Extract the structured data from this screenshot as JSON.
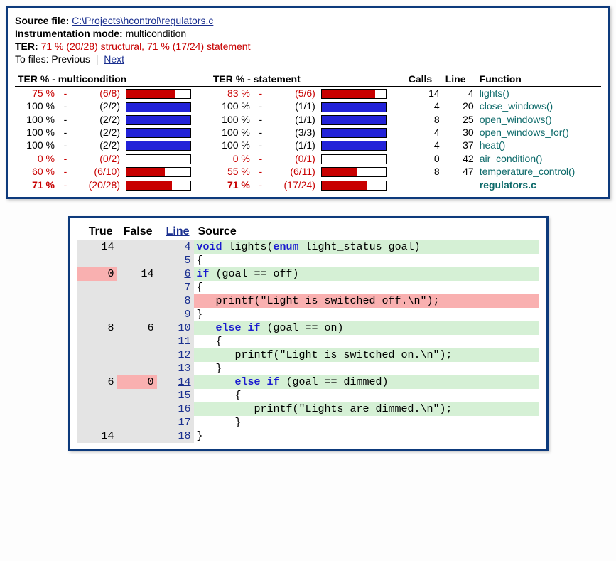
{
  "header": {
    "source_label": "Source file:",
    "source_path": "C:\\Projects\\hcontrol\\regulators.c",
    "mode_label": "Instrumentation mode:",
    "mode_value": "multicondition",
    "ter_label": "TER:",
    "ter_value": "71 % (20/28) structural, 71 % (17/24) statement",
    "tofiles_label": "To files:",
    "prev": "Previous",
    "next": "Next"
  },
  "cols": {
    "mc": "TER % - multicondition",
    "st": "TER % - statement",
    "calls": "Calls",
    "line": "Line",
    "func": "Function"
  },
  "rows": [
    {
      "mc_pct": "75 %",
      "mc_ratio": "(6/8)",
      "mc_fill": 75,
      "mc_bad": true,
      "st_pct": "83 %",
      "st_ratio": "(5/6)",
      "st_fill": 83,
      "st_bad": true,
      "calls": "14",
      "line": "4",
      "func": "lights()"
    },
    {
      "mc_pct": "100 %",
      "mc_ratio": "(2/2)",
      "mc_fill": 100,
      "mc_bad": false,
      "st_pct": "100 %",
      "st_ratio": "(1/1)",
      "st_fill": 100,
      "st_bad": false,
      "calls": "4",
      "line": "20",
      "func": "close_windows()"
    },
    {
      "mc_pct": "100 %",
      "mc_ratio": "(2/2)",
      "mc_fill": 100,
      "mc_bad": false,
      "st_pct": "100 %",
      "st_ratio": "(1/1)",
      "st_fill": 100,
      "st_bad": false,
      "calls": "8",
      "line": "25",
      "func": "open_windows()"
    },
    {
      "mc_pct": "100 %",
      "mc_ratio": "(2/2)",
      "mc_fill": 100,
      "mc_bad": false,
      "st_pct": "100 %",
      "st_ratio": "(3/3)",
      "st_fill": 100,
      "st_bad": false,
      "calls": "4",
      "line": "30",
      "func": "open_windows_for()"
    },
    {
      "mc_pct": "100 %",
      "mc_ratio": "(2/2)",
      "mc_fill": 100,
      "mc_bad": false,
      "st_pct": "100 %",
      "st_ratio": "(1/1)",
      "st_fill": 100,
      "st_bad": false,
      "calls": "4",
      "line": "37",
      "func": "heat()"
    },
    {
      "mc_pct": "0 %",
      "mc_ratio": "(0/2)",
      "mc_fill": 0,
      "mc_bad": true,
      "st_pct": "0 %",
      "st_ratio": "(0/1)",
      "st_fill": 0,
      "st_bad": true,
      "calls": "0",
      "line": "42",
      "func": "air_condition()"
    },
    {
      "mc_pct": "60 %",
      "mc_ratio": "(6/10)",
      "mc_fill": 60,
      "mc_bad": true,
      "st_pct": "55 %",
      "st_ratio": "(6/11)",
      "st_fill": 55,
      "st_bad": true,
      "calls": "8",
      "line": "47",
      "func": "temperature_control()"
    }
  ],
  "total": {
    "mc_pct": "71 %",
    "mc_ratio": "(20/28)",
    "mc_fill": 71,
    "st_pct": "71 %",
    "st_ratio": "(17/24)",
    "st_fill": 71,
    "file": "regulators.c"
  },
  "src_cols": {
    "true": "True",
    "false": "False",
    "line": "Line",
    "source": "Source"
  },
  "src_rows": [
    {
      "t": "14",
      "f": "",
      "t0": false,
      "f0": false,
      "ln": "4",
      "lnu": false,
      "cov": "g",
      "tokens": [
        [
          "kw",
          "void"
        ],
        [
          "pln",
          " lights("
        ],
        [
          "kw",
          "enum"
        ],
        [
          "pln",
          " light_status goal)"
        ]
      ]
    },
    {
      "t": "",
      "f": "",
      "t0": false,
      "f0": false,
      "ln": "5",
      "lnu": false,
      "cov": "",
      "tokens": [
        [
          "pln",
          "{"
        ]
      ]
    },
    {
      "t": "0",
      "f": "14",
      "t0": true,
      "f0": false,
      "ln": "6",
      "lnu": true,
      "cov": "g",
      "tokens": [
        [
          "kw",
          "if"
        ],
        [
          "pln",
          " (goal == off)"
        ]
      ]
    },
    {
      "t": "",
      "f": "",
      "t0": false,
      "f0": false,
      "ln": "7",
      "lnu": false,
      "cov": "",
      "tokens": [
        [
          "pln",
          "{"
        ]
      ]
    },
    {
      "t": "",
      "f": "",
      "t0": false,
      "f0": false,
      "ln": "8",
      "lnu": false,
      "cov": "r",
      "tokens": [
        [
          "pln",
          "   printf(\"Light is switched off.\\n\");"
        ]
      ]
    },
    {
      "t": "",
      "f": "",
      "t0": false,
      "f0": false,
      "ln": "9",
      "lnu": false,
      "cov": "",
      "tokens": [
        [
          "pln",
          "}"
        ]
      ]
    },
    {
      "t": "8",
      "f": "6",
      "t0": false,
      "f0": false,
      "ln": "10",
      "lnu": false,
      "cov": "g",
      "tokens": [
        [
          "pln",
          "   "
        ],
        [
          "kw",
          "else if"
        ],
        [
          "pln",
          " (goal == on)"
        ]
      ]
    },
    {
      "t": "",
      "f": "",
      "t0": false,
      "f0": false,
      "ln": "11",
      "lnu": false,
      "cov": "",
      "tokens": [
        [
          "pln",
          "   {"
        ]
      ]
    },
    {
      "t": "",
      "f": "",
      "t0": false,
      "f0": false,
      "ln": "12",
      "lnu": false,
      "cov": "g",
      "tokens": [
        [
          "pln",
          "      printf(\"Light is switched on.\\n\");"
        ]
      ]
    },
    {
      "t": "",
      "f": "",
      "t0": false,
      "f0": false,
      "ln": "13",
      "lnu": false,
      "cov": "",
      "tokens": [
        [
          "pln",
          "   }"
        ]
      ]
    },
    {
      "t": "6",
      "f": "0",
      "t0": false,
      "f0": true,
      "ln": "14",
      "lnu": true,
      "cov": "g",
      "tokens": [
        [
          "pln",
          "      "
        ],
        [
          "kw",
          "else if"
        ],
        [
          "pln",
          " (goal == dimmed)"
        ]
      ]
    },
    {
      "t": "",
      "f": "",
      "t0": false,
      "f0": false,
      "ln": "15",
      "lnu": false,
      "cov": "",
      "tokens": [
        [
          "pln",
          "      {"
        ]
      ]
    },
    {
      "t": "",
      "f": "",
      "t0": false,
      "f0": false,
      "ln": "16",
      "lnu": false,
      "cov": "g",
      "tokens": [
        [
          "pln",
          "         printf(\"Lights are dimmed.\\n\");"
        ]
      ]
    },
    {
      "t": "",
      "f": "",
      "t0": false,
      "f0": false,
      "ln": "17",
      "lnu": false,
      "cov": "",
      "tokens": [
        [
          "pln",
          "      }"
        ]
      ]
    },
    {
      "t": "14",
      "f": "",
      "t0": false,
      "f0": false,
      "ln": "18",
      "lnu": false,
      "cov": "",
      "tokens": [
        [
          "pln",
          "}"
        ]
      ]
    }
  ]
}
